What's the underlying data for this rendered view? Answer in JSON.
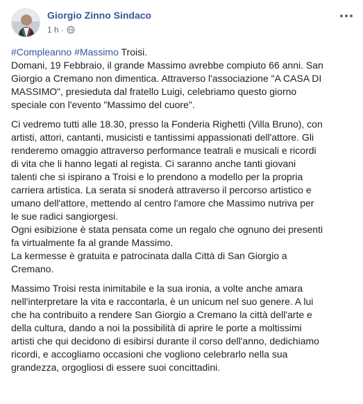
{
  "post": {
    "author": "Giorgio Zinno Sindaco",
    "time": "1 h",
    "separator": "·",
    "privacy_icon": "globe-icon",
    "more_icon": "more-options-icon",
    "hashtags": [
      "#Compleanno",
      "#Massimo"
    ],
    "first_line_rest": " Troisi.",
    "paragraphs": [
      [
        "Domani, 19 Febbraio, il grande Massimo avrebbe compiuto 66 anni. San",
        "Giorgio a Cremano non dimentica. Attraverso l'associazione \"A CASA DI",
        "MASSIMO\", presieduta dal fratello Luigi, celebriamo questo giorno",
        "speciale con l'evento \"Massimo del cuore\"."
      ],
      [
        "Ci vedremo tutti alle 18.30, presso la Fonderia Righetti (Villa Bruno), con",
        "artisti, attori, cantanti, musicisti e tantissimi appassionati dell'attore. Gli",
        "renderemo omaggio attraverso performance teatrali e musicali e ricordi",
        "di vita che li hanno legati al regista. Ci saranno anche tanti giovani",
        "talenti che si ispirano a Troisi e lo prendono a modello per la propria",
        "carriera artistica. La serata si snoderà attraverso il percorso artistico e",
        "umano dell'attore, mettendo al centro l'amore che Massimo nutriva per",
        "le sue radici sangiorgesi.",
        "Ogni esibizione è stata pensata come un regalo che ognuno dei presenti",
        "fa virtualmente fa al grande Massimo.",
        "La kermesse è gratuita e patrocinata dalla Città di San Giorgio a",
        "Cremano."
      ],
      [
        "Massimo Troisi resta inimitabile e la sua ironia, a volte anche amara",
        "nell'interpretare la vita e raccontarla, è un unicum nel suo genere. A lui",
        "che ha contribuito a rendere San Giorgio a Cremano la città dell'arte e",
        "della cultura, dando a noi la possibilità di aprire le porte a moltissimi",
        "artisti che qui decidono di esibirsi durante il corso dell'anno, dedichiamo",
        "ricordi, e accogliamo occasioni che vogliono celebrarlo nella sua",
        "grandezza, orgogliosi di essere suoi concittadini."
      ]
    ]
  },
  "colors": {
    "link": "#365899",
    "text": "#1c1e21",
    "meta": "#616770"
  }
}
